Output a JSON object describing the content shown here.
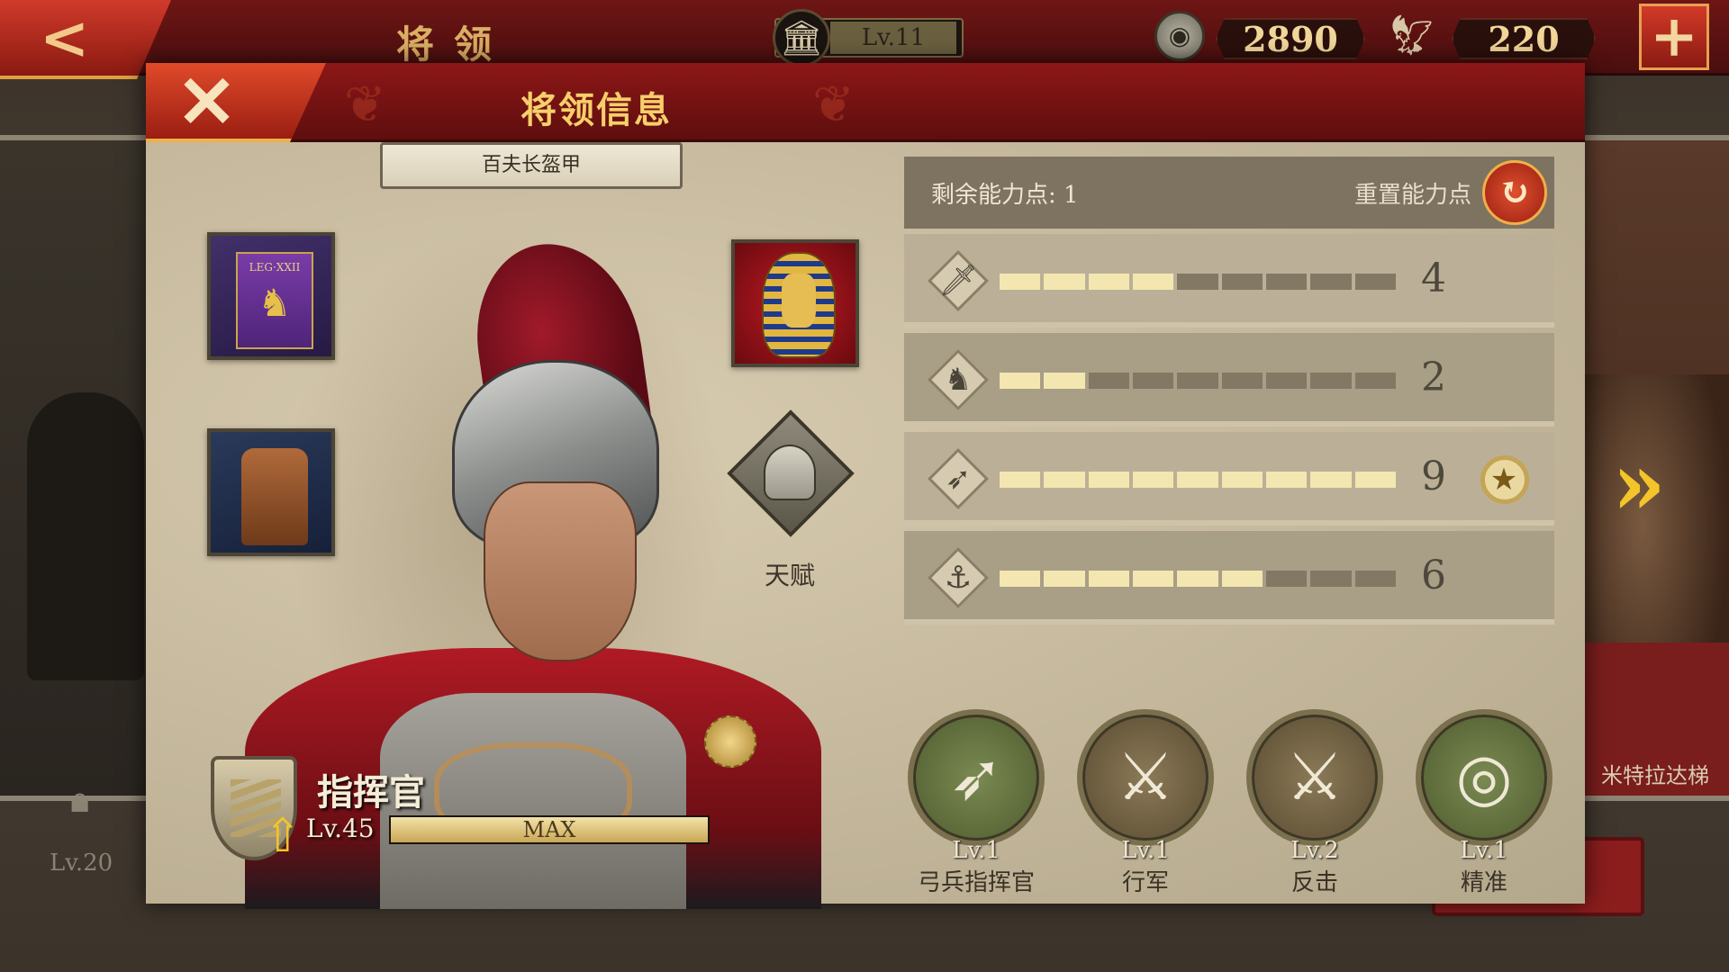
{
  "topbar": {
    "title": "将领",
    "castle_level": "Lv.11",
    "coins": "2890",
    "eagle_currency": "220",
    "plus": "+"
  },
  "background": {
    "left_card_level": "Lv.20",
    "right_card_name": "米特拉达梯"
  },
  "modal": {
    "title": "将领信息",
    "armor_name": "百夫长盔甲",
    "talent_label": "天赋",
    "commander": {
      "rank_title": "指挥官",
      "level": "Lv.45",
      "xp_label": "MAX",
      "xp_fraction": 1.0
    },
    "stats": {
      "remaining_label": "剩余能力点:",
      "remaining_value": "1",
      "reset_label": "重置能力点",
      "rows": [
        {
          "icon": "sword-icon",
          "value": 4,
          "max": 9
        },
        {
          "icon": "horse-icon",
          "value": 2,
          "max": 9
        },
        {
          "icon": "bow-icon",
          "value": 9,
          "max": 9,
          "medal": true
        },
        {
          "icon": "anchor-icon",
          "value": 6,
          "max": 9
        }
      ]
    },
    "skills": [
      {
        "icon": "bow-icon",
        "level": "Lv.1",
        "name": "弓兵指挥官",
        "style": "green"
      },
      {
        "icon": "march-icon",
        "level": "Lv.1",
        "name": "行军",
        "style": "brown"
      },
      {
        "icon": "counterattack-icon",
        "level": "Lv.2",
        "name": "反击",
        "style": "brown"
      },
      {
        "icon": "target-icon",
        "level": "Lv.1",
        "name": "精准",
        "style": "green"
      }
    ]
  }
}
